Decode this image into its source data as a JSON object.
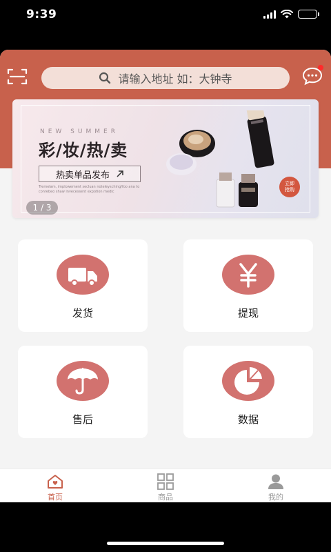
{
  "status_bar": {
    "time": "9:39"
  },
  "header": {
    "search_placeholder": "请输入地址  如：大钟寺"
  },
  "banner": {
    "subtitle": "NEW SUMMER",
    "title": "彩/妆/热/卖",
    "tag": "热卖单品发布",
    "fine_print": "Tremelam, implowement secluan noteleysching/foo ana to conrebeo shaw invecessent expotion medic",
    "badge": "立即抢购",
    "pagination": "1 / 3"
  },
  "actions": [
    {
      "label": "发货",
      "icon": "truck-icon"
    },
    {
      "label": "提现",
      "icon": "yen-icon"
    },
    {
      "label": "售后",
      "icon": "umbrella-icon"
    },
    {
      "label": "数据",
      "icon": "pie-chart-icon"
    }
  ],
  "tabbar": {
    "tabs": [
      {
        "label": "首页",
        "icon": "home-icon",
        "active": true
      },
      {
        "label": "商品",
        "icon": "grid-icon",
        "active": false
      },
      {
        "label": "我的",
        "icon": "user-icon",
        "active": false
      }
    ]
  },
  "colors": {
    "brand": "#c8614c",
    "icon_circle": "#d2726f",
    "active_tab": "#c8614c",
    "inactive_tab": "#9a9a9a"
  }
}
